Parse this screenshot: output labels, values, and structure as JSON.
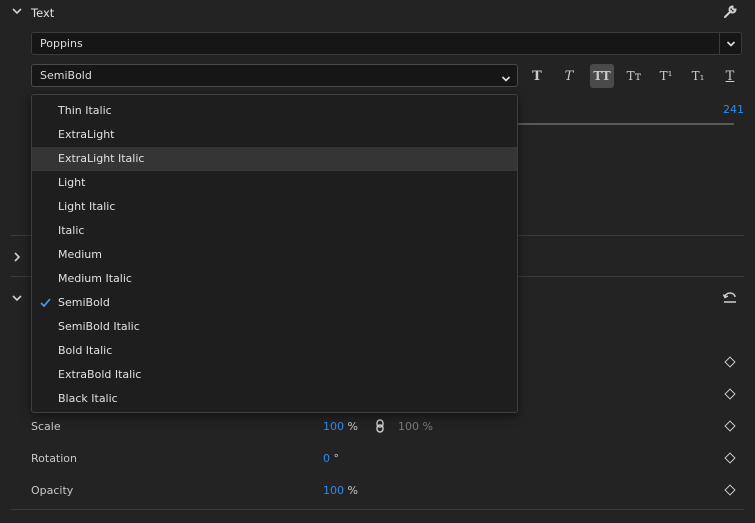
{
  "text_section": {
    "title": "Text",
    "font_family": "Poppins",
    "font_style": "SemiBold",
    "slider_value": "241"
  },
  "type_buttons": [
    {
      "glyph": "T",
      "name": "bold"
    },
    {
      "glyph": "T",
      "name": "italic"
    },
    {
      "glyph": "TT",
      "name": "all-caps"
    },
    {
      "glyph": "Tт",
      "name": "small-caps"
    },
    {
      "glyph": "T¹",
      "name": "superscript"
    },
    {
      "glyph": "T₁",
      "name": "subscript"
    },
    {
      "glyph": "T",
      "name": "underline"
    }
  ],
  "style_menu": {
    "items": [
      "Thin Italic",
      "ExtraLight",
      "ExtraLight Italic",
      "Light",
      "Light Italic",
      "Italic",
      "Medium",
      "Medium Italic",
      "SemiBold",
      "SemiBold Italic",
      "Bold Italic",
      "ExtraBold Italic",
      "Black Italic"
    ],
    "hovered": "ExtraLight Italic",
    "selected": "SemiBold"
  },
  "transform": {
    "scale_label": "Scale",
    "scale_value": "100",
    "scale_unit": "%",
    "scale_linked_value": "100 %",
    "rotation_label": "Rotation",
    "rotation_value": "0",
    "rotation_unit": "°",
    "opacity_label": "Opacity",
    "opacity_value": "100",
    "opacity_unit": "%"
  },
  "colors": {
    "accent": "#2d8ceb",
    "background": "#232323",
    "menu_bg": "#1e1e1e"
  }
}
